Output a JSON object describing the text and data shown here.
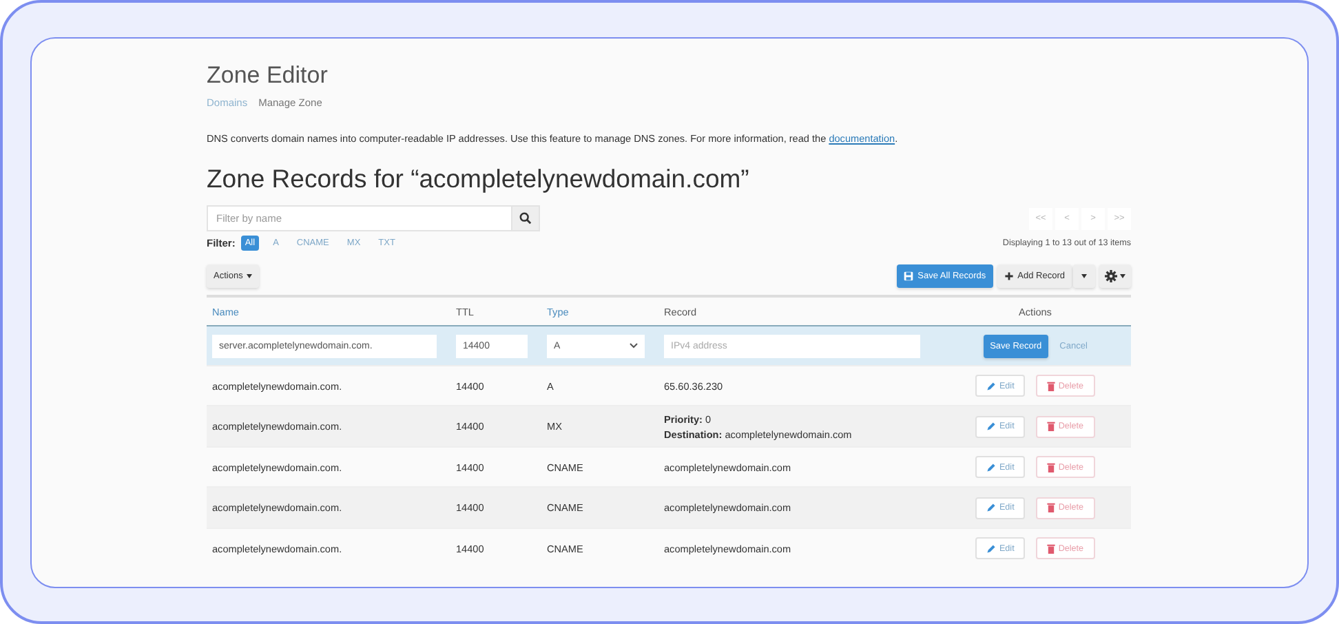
{
  "header": {
    "title": "Zone Editor",
    "breadcrumb": [
      {
        "label": "Domains",
        "link": true
      },
      {
        "label": "Manage Zone",
        "link": false
      }
    ]
  },
  "description": {
    "text": "DNS converts domain names into computer-readable IP addresses. Use this feature to manage DNS zones. For more information, read the",
    "link": "documentation",
    "end": "."
  },
  "heading": "Zone Records for “acompletelynewdomain.com”",
  "search": {
    "placeholder": "Filter by name"
  },
  "pagination": [
    "<<",
    "<",
    ">",
    ">>"
  ],
  "filter": {
    "label": "Filter:",
    "options": [
      {
        "label": "All",
        "selected": true
      },
      {
        "label": "A",
        "selected": false
      },
      {
        "label": "CNAME",
        "selected": false
      },
      {
        "label": "MX",
        "selected": false
      },
      {
        "label": "TXT",
        "selected": false
      }
    ]
  },
  "summary": "Displaying 1 to 13 out of 13 items",
  "toolbar": {
    "actions": "Actions",
    "save_all": "Save All Records",
    "add": "Add Record"
  },
  "table": {
    "columns": [
      {
        "label": "Name",
        "sortable": true
      },
      {
        "label": "TTL",
        "sortable": false
      },
      {
        "label": "Type",
        "sortable": true
      },
      {
        "label": "Record",
        "sortable": false
      },
      {
        "label": "Actions",
        "sortable": false
      }
    ],
    "new_record": {
      "name": "server.acompletelynewdomain.com.",
      "ttl": "14400",
      "type": "A",
      "record_placeholder": "IPv4 address",
      "save": "Save Record",
      "cancel": "Cancel"
    },
    "rows": [
      {
        "name": "acompletelynewdomain.com.",
        "ttl": "14400",
        "type": "A",
        "record": [
          "65.60.36.230"
        ],
        "edit": "Edit",
        "delete": "Delete"
      },
      {
        "name": "acompletelynewdomain.com.",
        "ttl": "14400",
        "type": "MX",
        "record": [
          "**Priority:** 0",
          "**Destination:** acompletelynewdomain.com"
        ],
        "edit": "Edit",
        "delete": "Delete"
      },
      {
        "name": "acompletelynewdomain.com.",
        "ttl": "14400",
        "type": "CNAME",
        "record": [
          "acompletelynewdomain.com"
        ],
        "edit": "Edit",
        "delete": "Delete"
      },
      {
        "name": "acompletelynewdomain.com.",
        "ttl": "14400",
        "type": "CNAME",
        "record": [
          "acompletelynewdomain.com"
        ],
        "edit": "Edit",
        "delete": "Delete"
      },
      {
        "name": "acompletelynewdomain.com.",
        "ttl": "14400",
        "type": "CNAME",
        "record": [
          "acompletelynewdomain.com"
        ],
        "edit": "Edit",
        "delete": "Delete"
      }
    ]
  }
}
